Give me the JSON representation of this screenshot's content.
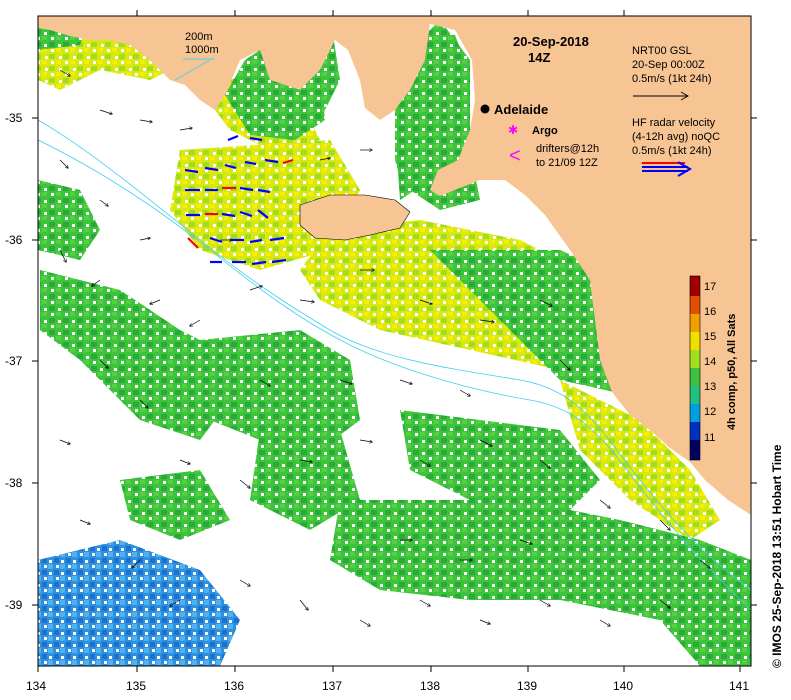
{
  "map": {
    "date": "20-Sep-2018",
    "time": "14Z",
    "x_ticks": [
      "134",
      "135",
      "136",
      "137",
      "138",
      "139",
      "140",
      "141"
    ],
    "y_ticks": [
      "-35",
      "-36",
      "-37",
      "-38",
      "-39"
    ]
  },
  "legend": {
    "depth_200": "200m",
    "depth_1000": "1000m",
    "adelaide": "Adelaide",
    "argo": "Argo",
    "drifters_line1": "drifters@12h",
    "drifters_line2": "to 21/09 12Z",
    "nrt_line1": "NRT00 GSL",
    "nrt_line2": "20-Sep 00:00Z",
    "nrt_line3": "0.5m/s (1kt 24h)",
    "hf_line1": "HF radar velocity",
    "hf_line2": "(4-12h avg) noQC",
    "hf_line3": "0.5m/s (1kt 24h)"
  },
  "colorbar": {
    "label": "4h comp, p50, All Sats",
    "ticks": [
      "11",
      "12",
      "13",
      "14",
      "15",
      "16",
      "17"
    ],
    "colors": [
      "#000060",
      "#0030c0",
      "#00a0e0",
      "#20c080",
      "#40c040",
      "#a0e020",
      "#f0e000",
      "#f0a000",
      "#e05000",
      "#a00000"
    ]
  },
  "credit": "© IMOS 25-Sep-2018 13:51 Hobart Time",
  "colors": {
    "land": "#f7c493",
    "sst_green": "#3cc43c",
    "sst_yellow": "#e8e800",
    "sst_blue": "#2080e0",
    "isobath": "#40d0f0",
    "drifter": "#ff00ff",
    "hf_blue": "#0000ff",
    "hf_red": "#ff0000"
  }
}
